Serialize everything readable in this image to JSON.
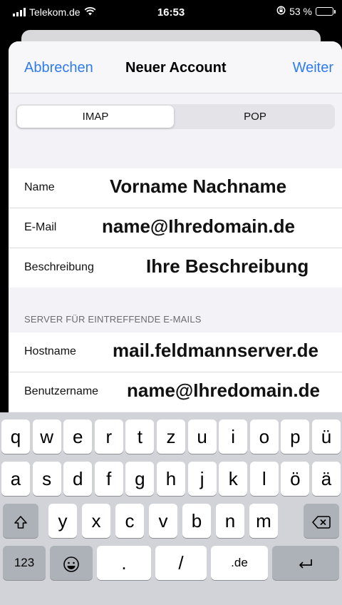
{
  "status_bar": {
    "carrier": "Telekom.de",
    "time": "16:53",
    "battery_text": "53 %",
    "battery_level": 0.53
  },
  "navbar": {
    "cancel": "Abbrechen",
    "title": "Neuer Account",
    "next": "Weiter"
  },
  "segment": {
    "options": [
      "IMAP",
      "POP"
    ],
    "selected": "IMAP"
  },
  "account_fields": [
    {
      "label": "Name",
      "value": "Vorname Nachname"
    },
    {
      "label": "E-Mail",
      "value": "name@Ihredomain.de"
    },
    {
      "label": "Beschreibung",
      "value": "Ihre Beschreibung"
    }
  ],
  "incoming_server": {
    "header": "SERVER FÜR EINTREFFENDE E-MAILS",
    "fields": [
      {
        "label": "Hostname",
        "value": "mail.feldmannserver.de"
      },
      {
        "label": "Benutzername",
        "value": "name@Ihredomain.de"
      }
    ]
  },
  "keyboard": {
    "row1": [
      "q",
      "w",
      "e",
      "r",
      "t",
      "z",
      "u",
      "i",
      "o",
      "p",
      "ü"
    ],
    "row2": [
      "a",
      "s",
      "d",
      "f",
      "g",
      "h",
      "j",
      "k",
      "l",
      "ö",
      "ä"
    ],
    "row3": [
      "y",
      "x",
      "c",
      "v",
      "b",
      "n",
      "m"
    ],
    "numbers_key": "123",
    "dot_key": ".",
    "slash_key": "/",
    "de_key": ".de",
    "icons": {
      "shift": "shift-icon",
      "delete": "delete-icon",
      "emoji": "emoji-icon",
      "return": "return-icon"
    }
  },
  "colors": {
    "accent": "#2f7bf3",
    "battery_fill": "#36c759"
  }
}
